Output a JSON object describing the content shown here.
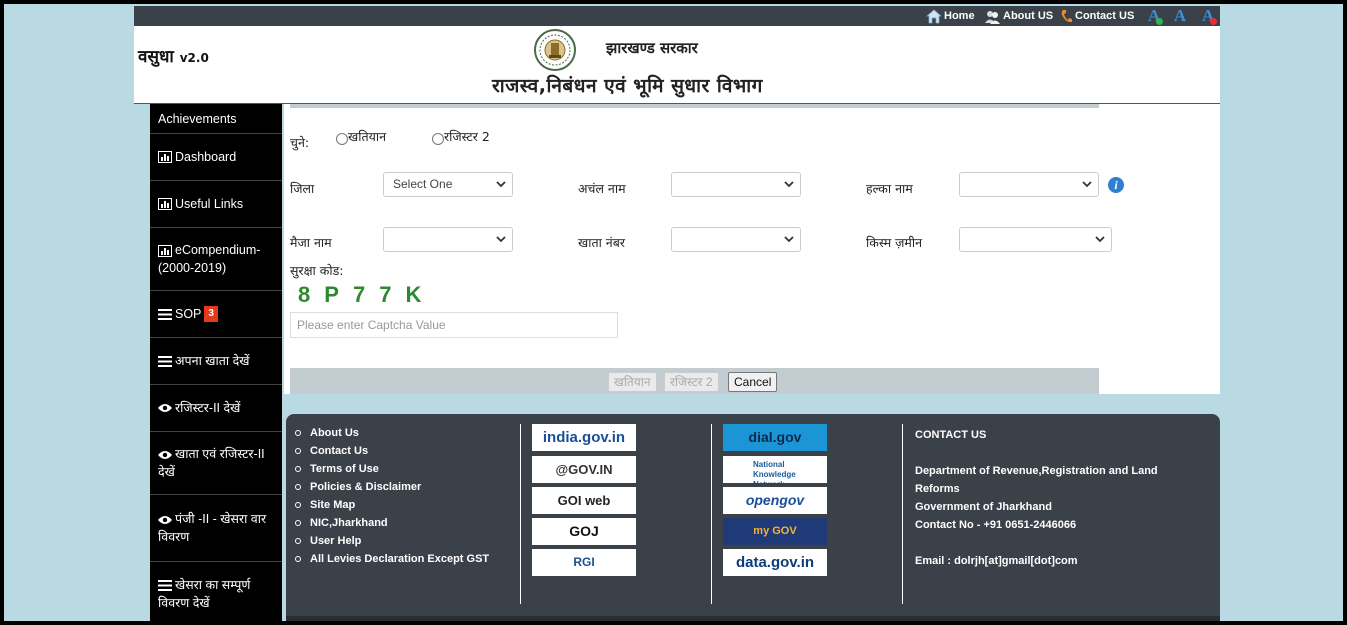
{
  "topbar": {
    "home": "Home",
    "about": "About US",
    "contact": "Contact US",
    "font_increase": "A",
    "font_normal": "A",
    "font_decrease": "A"
  },
  "header": {
    "brand": "वसुधा",
    "version": "v2.0",
    "government": "झारखण्ड सरकार",
    "department": "राजस्व,निबंधन एवं भूमि सुधार विभाग"
  },
  "sidebar": {
    "items": [
      {
        "label": "Achievements",
        "icon": "none"
      },
      {
        "label": "Dashboard",
        "icon": "bar-chart-icon"
      },
      {
        "label": "Useful Links",
        "icon": "bar-chart-icon"
      },
      {
        "label": "eCompendium-(2000-2019)",
        "icon": "bar-chart-icon"
      },
      {
        "label": "SOP",
        "icon": "list-icon",
        "badge": "3"
      },
      {
        "label": "अपना खाता देखें",
        "icon": "list-icon"
      },
      {
        "label": "रजिस्टर-II देखें",
        "icon": "eye-icon"
      },
      {
        "label": "खाता एवं रजिस्टर-II देखें",
        "icon": "eye-icon"
      },
      {
        "label": "पंजी -II - खेसरा वार विवरण",
        "icon": "eye-icon"
      },
      {
        "label": "खेसरा का सम्पूर्ण विवरण देखें",
        "icon": "list-icon"
      }
    ]
  },
  "form": {
    "choose_label": "चुने:",
    "radio_khatiyan": "खतियान",
    "radio_register2": "रजिस्टर 2",
    "district_label": "जिला",
    "district_value": "Select One",
    "anchal_label": "अचंल नाम",
    "anchal_value": "",
    "halka_label": "हल्का नाम",
    "halka_value": "",
    "mauza_label": "मैजा नाम",
    "mauza_value": "",
    "khata_label": "खाता नंबर",
    "khata_value": "",
    "kism_label": "किस्म ज़मीन",
    "kism_value": "",
    "security_label": "सुरक्षा कोड:",
    "captcha": [
      "8",
      "P",
      "7",
      "7",
      "K"
    ],
    "captcha_placeholder": "Please enter Captcha Value",
    "btn_khatiyan": "खतियान",
    "btn_register2": "रजिस्टर 2",
    "btn_cancel": "Cancel"
  },
  "footer": {
    "links": [
      "About Us",
      "Contact Us",
      "Terms of Use",
      "Policies & Disclaimer",
      "Site Map",
      "NIC,Jharkhand",
      "User Help",
      "All Levies Declaration Except GST"
    ],
    "logos_left": [
      "india.gov.in",
      "@GOV.IN",
      "GOI web directory",
      "GOJ",
      "RGI"
    ],
    "logos_right": [
      "dial.gov",
      "National Knowledge Network",
      "opengov",
      "my GOV",
      "data.gov.in"
    ],
    "contact_heading": "CONTACT US",
    "contact_dept": "Department of Revenue,Registration and Land Reforms",
    "contact_gov": "Government of Jharkhand",
    "contact_phone": "Contact No - +91 0651-2446066",
    "contact_email": "Email : dolrjh[at]gmail[dot]com"
  },
  "colors": {
    "frame_bg": "#b9d9e3",
    "bar_dark": "#3b4148",
    "sidebar_bg": "#000000",
    "badge": "#e53a1a",
    "captcha": "#2f8a2f",
    "info": "#2f7fd0"
  }
}
